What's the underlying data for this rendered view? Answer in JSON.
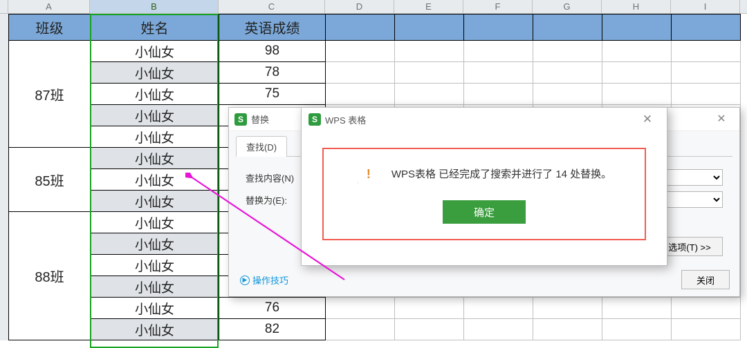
{
  "columns": {
    "A": "A",
    "B": "B",
    "C": "C",
    "D": "D",
    "E": "E",
    "F": "F",
    "G": "G",
    "H": "H",
    "I": "I"
  },
  "header": {
    "A": "班级",
    "B": "姓名",
    "C": "英语成绩"
  },
  "rows": [
    {
      "class_rowspan": 5,
      "class": "87班",
      "name": "小仙女",
      "score": "98",
      "dark": false
    },
    {
      "name": "小仙女",
      "score": "78",
      "dark": true
    },
    {
      "name": "小仙女",
      "score": "75",
      "dark": false
    },
    {
      "name": "小仙女",
      "score": "",
      "dark": true
    },
    {
      "name": "小仙女",
      "score": "",
      "dark": false
    },
    {
      "class_rowspan": 3,
      "class": "85班",
      "name": "小仙女",
      "score": "",
      "dark": true
    },
    {
      "name": "小仙女",
      "score": "",
      "dark": false
    },
    {
      "name": "小仙女",
      "score": "",
      "dark": true
    },
    {
      "class_rowspan": 6,
      "class": "88班",
      "name": "小仙女",
      "score": "",
      "dark": false
    },
    {
      "name": "小仙女",
      "score": "",
      "dark": true
    },
    {
      "name": "小仙女",
      "score": "",
      "dark": false
    },
    {
      "name": "小仙女",
      "score": "",
      "dark": true
    },
    {
      "name": "小仙女",
      "score": "76",
      "dark": false
    },
    {
      "name": "小仙女",
      "score": "82",
      "dark": true
    }
  ],
  "replaceDialog": {
    "title": "替换",
    "tab_find": "查找(D)",
    "label_findwhat": "查找内容(N)",
    "label_replacewith": "替换为(E):",
    "options_btn": "选项(T) >>",
    "close_btn": "关闭",
    "tips": "操作技巧"
  },
  "alertDialog": {
    "title": "WPS 表格",
    "message": "WPS表格 已经完成了搜索并进行了 14 处替换。",
    "ok": "确定"
  }
}
